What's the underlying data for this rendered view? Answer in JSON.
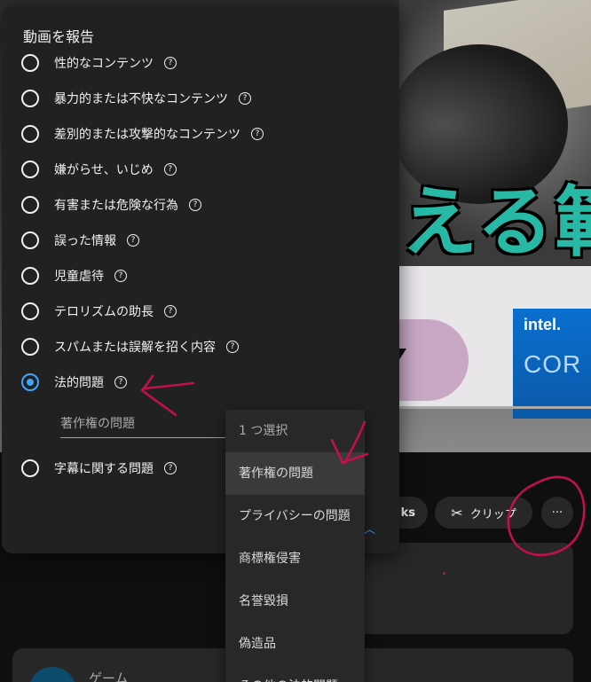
{
  "dialog": {
    "title": "動画を報告",
    "options": [
      {
        "label": "性的なコンテンツ",
        "checked": false
      },
      {
        "label": "暴力的または不快なコンテンツ",
        "checked": false
      },
      {
        "label": "差別的または攻撃的なコンテンツ",
        "checked": false
      },
      {
        "label": "嫌がらせ、いじめ",
        "checked": false
      },
      {
        "label": "有害または危険な行為",
        "checked": false
      },
      {
        "label": "誤った情報",
        "checked": false
      },
      {
        "label": "児童虐待",
        "checked": false
      },
      {
        "label": "テロリズムの助長",
        "checked": false
      },
      {
        "label": "スパムまたは誤解を招く内容",
        "checked": false
      },
      {
        "label": "法的問題",
        "checked": true
      },
      {
        "label": "字幕に関する問題",
        "checked": false
      }
    ],
    "help_glyph": "?",
    "subselect_value": "著作権の問題"
  },
  "dropdown": {
    "items": [
      {
        "label": "1 つ選択",
        "state": "placeholder"
      },
      {
        "label": "著作権の問題",
        "state": "hover"
      },
      {
        "label": "プライバシーの問題",
        "state": "normal"
      },
      {
        "label": "商標権侵害",
        "state": "normal"
      },
      {
        "label": "名誉毀損",
        "state": "normal"
      },
      {
        "label": "偽造品",
        "state": "normal"
      },
      {
        "label": "その他の法的問題",
        "state": "normal"
      }
    ]
  },
  "actions": {
    "thanks_label": "ks",
    "clip_label": "クリップ",
    "more_glyph": "···"
  },
  "video": {
    "overlay_text": "える範",
    "intel_logo": "intel.",
    "intel_core": "COR"
  },
  "below": {
    "game_label": "ゲーム"
  },
  "colors": {
    "accent": "#3ea6ff",
    "dialog_bg": "#212121",
    "annotation": "#c0104e",
    "overlay_text": "#27b9a6"
  }
}
